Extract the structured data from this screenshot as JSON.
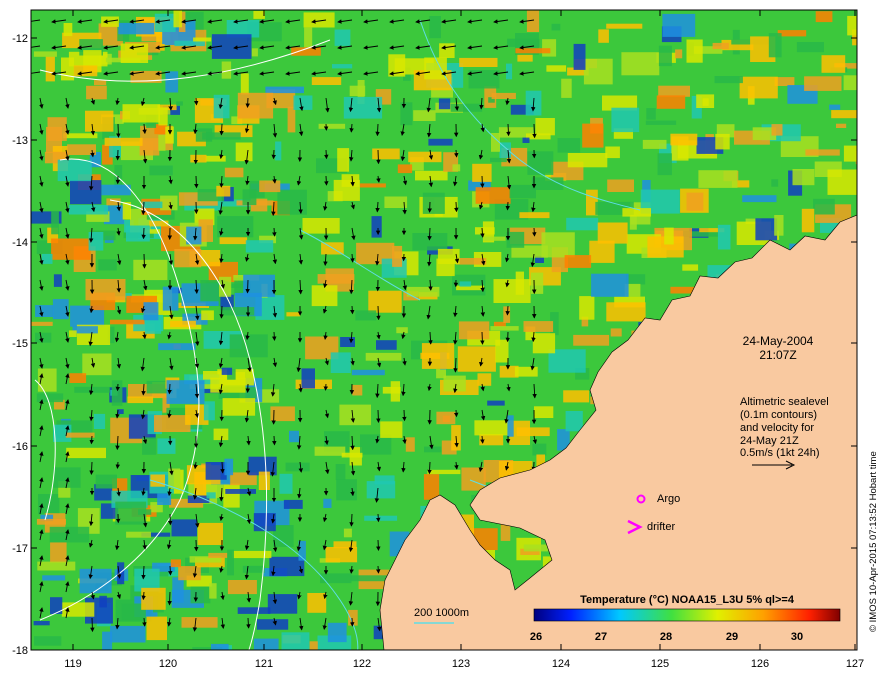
{
  "map": {
    "lon_ticks": [
      "119",
      "120",
      "121",
      "122",
      "123",
      "124",
      "125",
      "126",
      "127"
    ],
    "lat_ticks": [
      "-12",
      "-13",
      "-14",
      "-15",
      "-16",
      "-17",
      "-18"
    ]
  },
  "annotation": {
    "date": "24-May-2004",
    "time": "21:07Z",
    "altimetric": [
      "Altimetric sealevel",
      "(0.1m contours)",
      "and velocity for",
      "24-May 21Z",
      "0.5m/s (1kt 24h)"
    ]
  },
  "legend": {
    "argo": "Argo",
    "drifter": "drifter",
    "isobath": "200  1000m"
  },
  "colorbar": {
    "title": "Temperature (°C) NOAA15_L3U 5% ql>=4",
    "ticks": [
      "26",
      "27",
      "28",
      "29",
      "30"
    ]
  },
  "credit": "© IMOS 10-Apr-2015 07:13:52 Hobart time",
  "colors": {
    "land": "#f9c9a0",
    "marker": "#ff00ff",
    "isobath": "#5fdde6"
  }
}
